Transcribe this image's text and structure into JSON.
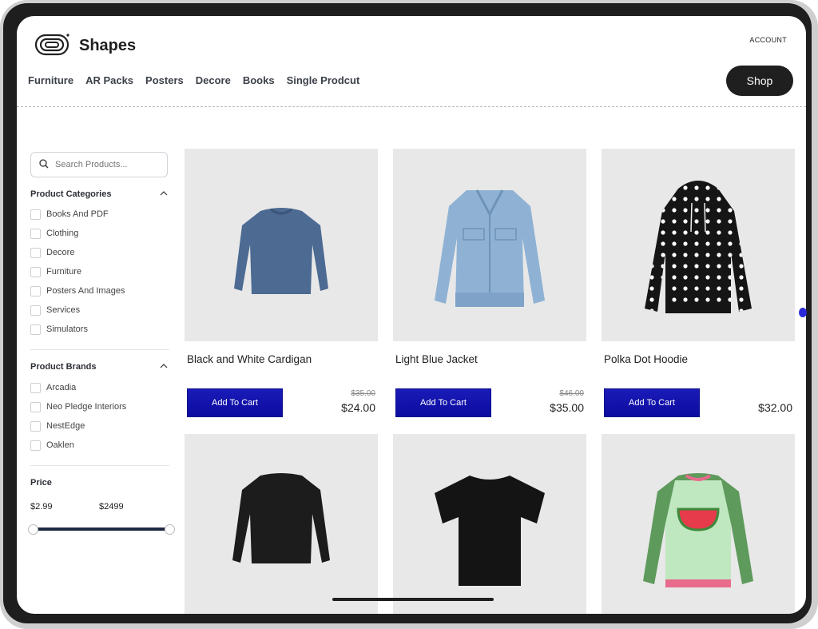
{
  "header": {
    "brand": "Shapes",
    "account": "ACCOUNT",
    "nav": [
      "Furniture",
      "AR Packs",
      "Posters",
      "Decore",
      "Books",
      "Single Prodcut"
    ],
    "shop_label": "Shop"
  },
  "sidebar": {
    "search_placeholder": "Search Products...",
    "categories_title": "Product Categories",
    "categories": [
      "Books And PDF",
      "Clothing",
      "Decore",
      "Furniture",
      "Posters And Images",
      "Services",
      "Simulators"
    ],
    "brands_title": "Product Brands",
    "brands": [
      "Arcadia",
      "Neo Pledge Interiors",
      "NestEdge",
      "Oaklen"
    ],
    "price_title": "Price",
    "price_min": "$2.99",
    "price_max": "$2499"
  },
  "products": [
    {
      "name": "Black and White Cardigan",
      "old_price": "$35.00",
      "price": "$24.00",
      "cart_label": "Add To Cart"
    },
    {
      "name": "Light Blue Jacket",
      "old_price": "$46.00",
      "price": "$35.00",
      "cart_label": "Add To Cart"
    },
    {
      "name": "Polka Dot Hoodie",
      "old_price": "",
      "price": "$32.00",
      "cart_label": "Add To Cart"
    }
  ],
  "colors": {
    "accent_button": "#1414b0",
    "dark": "#1f1f1f",
    "card_bg": "#e8e8e8"
  }
}
